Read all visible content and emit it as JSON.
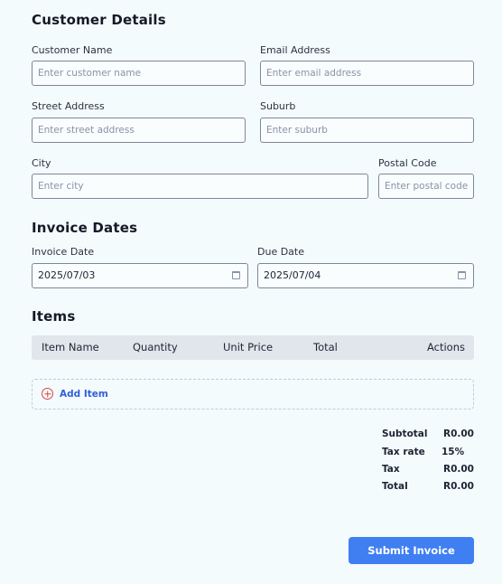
{
  "customer": {
    "title": "Customer Details",
    "name_label": "Customer Name",
    "name_placeholder": "Enter customer name",
    "email_label": "Email Address",
    "email_placeholder": "Enter email address",
    "street_label": "Street Address",
    "street_placeholder": "Enter street address",
    "suburb_label": "Suburb",
    "suburb_placeholder": "Enter suburb",
    "city_label": "City",
    "city_placeholder": "Enter city",
    "postal_label": "Postal Code",
    "postal_placeholder": "Enter postal code"
  },
  "dates": {
    "title": "Invoice Dates",
    "invoice_date_label": "Invoice Date",
    "invoice_date_value": "2025/07/03",
    "due_date_label": "Due Date",
    "due_date_value": "2025/07/04"
  },
  "items": {
    "title": "Items",
    "columns": [
      "Item Name",
      "Quantity",
      "Unit Price",
      "Total",
      "Actions"
    ],
    "add_label": "Add Item"
  },
  "summary": {
    "subtotal_label": "Subtotal",
    "subtotal_value": "R0.00",
    "taxrate_label": "Tax rate",
    "taxrate_value": "15%",
    "tax_label": "Tax",
    "tax_value": "R0.00",
    "total_label": "Total",
    "total_value": "R0.00"
  },
  "actions": {
    "submit_label": "Submit Invoice"
  },
  "colors": {
    "background": "#f4fbfd",
    "accent": "#3f7ff2",
    "add_icon": "#d64545",
    "link": "#2f5fd8"
  }
}
